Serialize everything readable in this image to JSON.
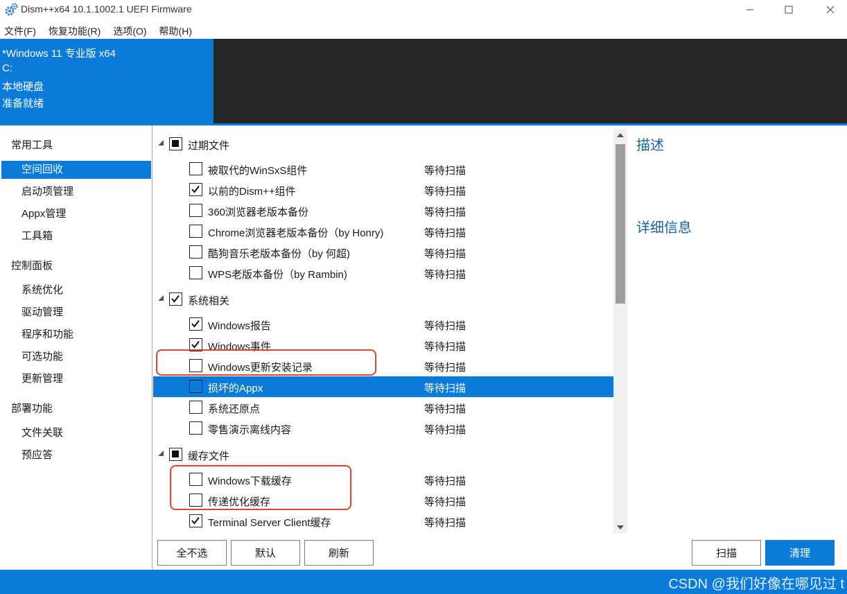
{
  "window": {
    "title": "Dism++x64 10.1.1002.1 UEFI Firmware"
  },
  "menu": {
    "items": [
      {
        "label": "文件(F)"
      },
      {
        "label": "恢复功能(R)"
      },
      {
        "label": "选项(O)"
      },
      {
        "label": "帮助(H)"
      }
    ]
  },
  "header": {
    "os": "*Windows 11 专业版 x64",
    "drive": "C:",
    "disk_type": "本地硬盘",
    "status": "准备就绪"
  },
  "sidebar": {
    "groups": [
      {
        "label": "常用工具",
        "items": [
          {
            "label": "空间回收",
            "active": true
          },
          {
            "label": "启动项管理"
          },
          {
            "label": "Appx管理"
          },
          {
            "label": "工具箱"
          }
        ]
      },
      {
        "label": "控制面板",
        "items": [
          {
            "label": "系统优化"
          },
          {
            "label": "驱动管理"
          },
          {
            "label": "程序和功能"
          },
          {
            "label": "可选功能"
          },
          {
            "label": "更新管理"
          }
        ]
      },
      {
        "label": "部署功能",
        "items": [
          {
            "label": "文件关联"
          },
          {
            "label": "预应答"
          }
        ]
      }
    ]
  },
  "cleanup": {
    "groups": [
      {
        "label": "过期文件",
        "state": "partial",
        "items": [
          {
            "label": "被取代的WinSxS组件",
            "checked": false,
            "status": "等待扫描"
          },
          {
            "label": "以前的Dism++组件",
            "checked": true,
            "status": "等待扫描"
          },
          {
            "label": "360浏览器老版本备份",
            "checked": false,
            "status": "等待扫描"
          },
          {
            "label": "Chrome浏览器老版本备份（by Honry)",
            "checked": false,
            "status": "等待扫描"
          },
          {
            "label": "酷狗音乐老版本备份（by 何超)",
            "checked": false,
            "status": "等待扫描"
          },
          {
            "label": "WPS老版本备份（by Rambin)",
            "checked": false,
            "status": "等待扫描"
          }
        ]
      },
      {
        "label": "系统相关",
        "state": "checked",
        "items": [
          {
            "label": "Windows报告",
            "checked": true,
            "status": "等待扫描"
          },
          {
            "label": "Windows事件",
            "checked": true,
            "status": "等待扫描"
          },
          {
            "label": "Windows更新安装记录",
            "checked": false,
            "status": "等待扫描"
          },
          {
            "label": "损坏的Appx",
            "checked": false,
            "status": "等待扫描",
            "selected": true
          },
          {
            "label": "系统还原点",
            "checked": false,
            "status": "等待扫描"
          },
          {
            "label": "零售演示离线内容",
            "checked": false,
            "status": "等待扫描"
          }
        ]
      },
      {
        "label": "缓存文件",
        "state": "partial",
        "items": [
          {
            "label": "Windows下载缓存",
            "checked": false,
            "status": "等待扫描"
          },
          {
            "label": "传递优化缓存",
            "checked": false,
            "status": "等待扫描"
          },
          {
            "label": "Terminal Server Client缓存",
            "checked": true,
            "status": "等待扫描"
          }
        ]
      }
    ]
  },
  "right_panel": {
    "description_title": "描述",
    "details_title": "详细信息"
  },
  "buttons": {
    "deselect_all": "全不选",
    "default": "默认",
    "refresh": "刷新",
    "scan": "扫描",
    "clean": "清理"
  },
  "watermark": "CSDN @我们好像在哪见过 t",
  "colors": {
    "accent": "#0a7bd8",
    "header_dark": "#262626",
    "annotation": "#e0442c",
    "panel_title": "#1565a6"
  }
}
